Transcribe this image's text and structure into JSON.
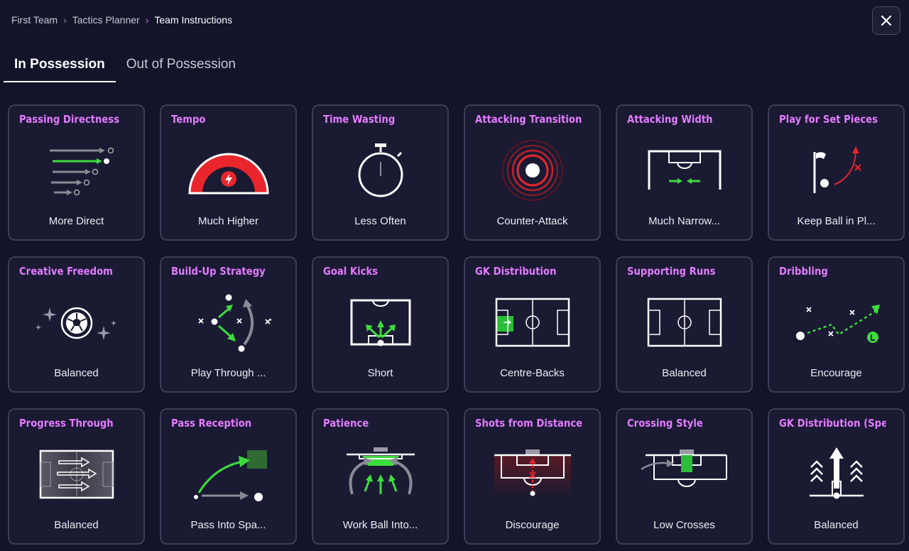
{
  "breadcrumb": [
    "First Team",
    "Tactics Planner",
    "Team Instructions"
  ],
  "tabs": [
    {
      "label": "In Possession",
      "active": true
    },
    {
      "label": "Out of Possession",
      "active": false
    }
  ],
  "colors": {
    "accent": "#c77dff",
    "title": "#e27bff",
    "green": "#3ddc3d",
    "red": "#e8262b"
  },
  "cards": [
    {
      "title": "Passing Directness",
      "value": "More Direct",
      "icon": "passing-directness-icon"
    },
    {
      "title": "Tempo",
      "value": "Much Higher",
      "icon": "tempo-gauge-icon"
    },
    {
      "title": "Time Wasting",
      "value": "Less Often",
      "icon": "stopwatch-icon"
    },
    {
      "title": "Attacking Transition",
      "value": "Counter-Attack",
      "icon": "radar-target-icon"
    },
    {
      "title": "Attacking Width",
      "value": "Much Narrow...",
      "icon": "attacking-width-icon"
    },
    {
      "title": "Play for Set Pieces",
      "value": "Keep Ball in Pl...",
      "icon": "set-pieces-icon"
    },
    {
      "title": "Creative Freedom",
      "value": "Balanced",
      "icon": "creative-ball-icon"
    },
    {
      "title": "Build-Up Strategy",
      "value": "Play Through ...",
      "icon": "build-up-icon"
    },
    {
      "title": "Goal Kicks",
      "value": "Short",
      "icon": "goal-kicks-icon"
    },
    {
      "title": "GK Distribution",
      "value": "Centre-Backs",
      "icon": "gk-distribution-pitch-icon"
    },
    {
      "title": "Supporting Runs",
      "value": "Balanced",
      "icon": "supporting-runs-pitch-icon"
    },
    {
      "title": "Dribbling",
      "value": "Encourage",
      "icon": "dribbling-icon"
    },
    {
      "title": "Progress Through",
      "value": "Balanced",
      "icon": "progress-through-icon"
    },
    {
      "title": "Pass Reception",
      "value": "Pass Into Spa...",
      "icon": "pass-reception-icon"
    },
    {
      "title": "Patience",
      "value": "Work Ball Into...",
      "icon": "patience-icon"
    },
    {
      "title": "Shots from Distance",
      "value": "Discourage",
      "icon": "shots-distance-icon"
    },
    {
      "title": "Crossing Style",
      "value": "Low Crosses",
      "icon": "crossing-style-icon"
    },
    {
      "title": "GK Distribution (Speed)",
      "value": "Balanced",
      "icon": "gk-speed-icon"
    }
  ]
}
